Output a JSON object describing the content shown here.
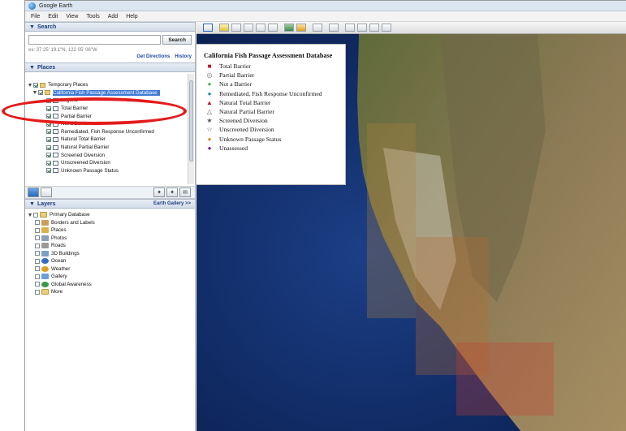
{
  "window": {
    "title": "Google Earth"
  },
  "menu": [
    "File",
    "Edit",
    "View",
    "Tools",
    "Add",
    "Help"
  ],
  "search": {
    "header": "Search",
    "input_value": "",
    "button": "Search",
    "coords": "ex: 37 25' 19.1\"N, 122 05' 06\"W",
    "links": [
      "Get Directions",
      "History"
    ]
  },
  "places": {
    "header": "Places",
    "items": [
      {
        "label": "Temporary Places",
        "checked": true
      },
      {
        "label": "California Fish Passage Assessment Database",
        "checked": true,
        "selected": true
      },
      {
        "label": "Legend",
        "checked": true
      },
      {
        "label": "Total Barrier",
        "checked": true
      },
      {
        "label": "Partial Barrier",
        "checked": true
      },
      {
        "label": "Not a Barrier",
        "checked": true
      },
      {
        "label": "Remediated, Fish Response Unconfirmed",
        "checked": true
      },
      {
        "label": "Natural Total Barrier",
        "checked": true
      },
      {
        "label": "Natural Partial Barrier",
        "checked": true
      },
      {
        "label": "Screened Diversion",
        "checked": true
      },
      {
        "label": "Unscreened Diversion",
        "checked": true
      },
      {
        "label": "Unknown Passage Status",
        "checked": true
      }
    ]
  },
  "layers": {
    "header": "Layers",
    "gallery": "Earth Gallery >>",
    "items": [
      {
        "label": "Primary Database",
        "color": "#e9d07a"
      },
      {
        "label": "Borders and Labels",
        "color": "#c8a05a"
      },
      {
        "label": "Places",
        "color": "#d9b24a"
      },
      {
        "label": "Photos",
        "color": "#8aa0b8"
      },
      {
        "label": "Roads",
        "color": "#9a9a9a"
      },
      {
        "label": "3D Buildings",
        "color": "#7aa0c8"
      },
      {
        "label": "Ocean",
        "color": "#2f6fc0"
      },
      {
        "label": "Weather",
        "color": "#e0a020"
      },
      {
        "label": "Gallery",
        "color": "#6a9fd8"
      },
      {
        "label": "Global Awareness",
        "color": "#3a9a4a"
      },
      {
        "label": "More",
        "color": "#e9d07a"
      }
    ]
  },
  "legend": {
    "title": "California Fish Passage Assessment Database",
    "items": [
      {
        "label": "Total Barrier",
        "symbol": "■",
        "color": "#c8102e"
      },
      {
        "label": "Partial Barrier",
        "symbol": "◎",
        "color": "#777777"
      },
      {
        "label": "Not a Barrier",
        "symbol": "●",
        "color": "#4caf50"
      },
      {
        "label": "Remediated, Fish Response Unconfirmed",
        "symbol": "●",
        "color": "#1a8f8f"
      },
      {
        "label": "Natural Total Barrier",
        "symbol": "▲",
        "color": "#c8102e"
      },
      {
        "label": "Natural Partial Barrier",
        "symbol": "△",
        "color": "#555555"
      },
      {
        "label": "Screened Diversion",
        "symbol": "★",
        "color": "#555555"
      },
      {
        "label": "Unscreened Diversion",
        "symbol": "☆",
        "color": "#555555"
      },
      {
        "label": "Unknown Passage Status",
        "symbol": "●",
        "color": "#e08a1e"
      },
      {
        "label": "Unassessed",
        "symbol": "●",
        "color": "#7b1fa2"
      }
    ]
  }
}
